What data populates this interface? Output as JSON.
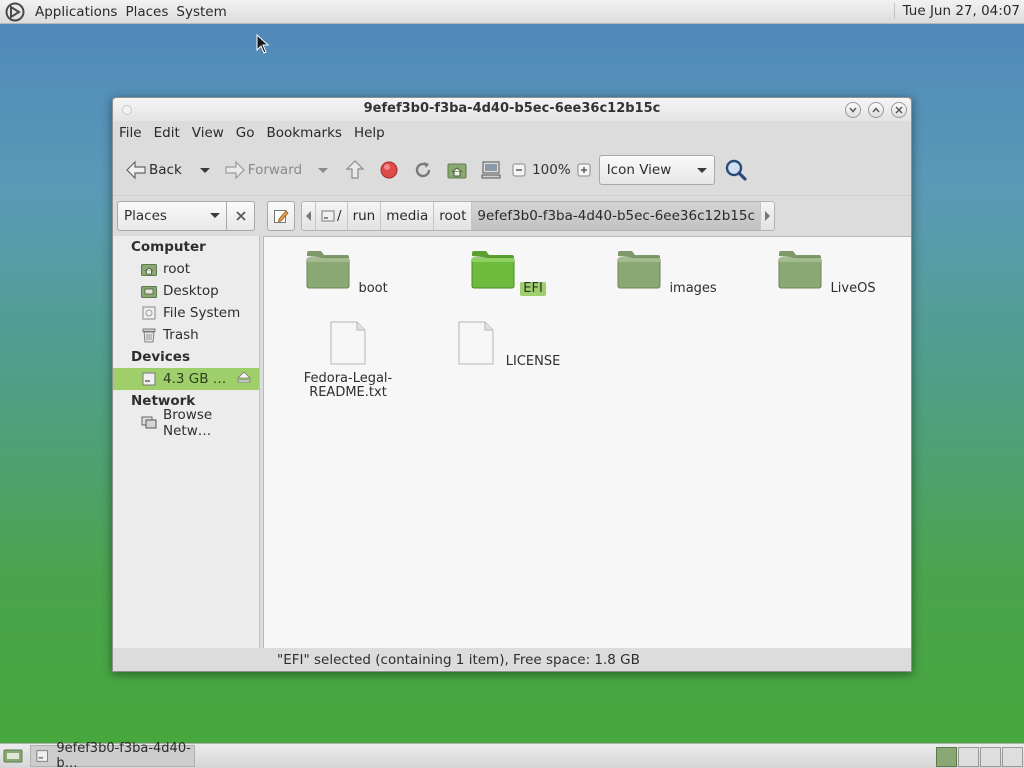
{
  "top_panel": {
    "menus": [
      "Applications",
      "Places",
      "System"
    ],
    "clock": "Tue Jun 27, 04:07"
  },
  "window": {
    "title": "9efef3b0-f3ba-4d40-b5ec-6ee36c12b15c",
    "menu": [
      "File",
      "Edit",
      "View",
      "Go",
      "Bookmarks",
      "Help"
    ],
    "toolbar": {
      "back_label": "Back",
      "forward_label": "Forward",
      "zoom": "100%",
      "view_mode": "Icon View"
    },
    "location": {
      "places_label": "Places",
      "crumbs": [
        "/",
        "run",
        "media",
        "root",
        "9efef3b0-f3ba-4d40-b5ec-6ee36c12b15c"
      ]
    },
    "sidebar": {
      "computer_heading": "Computer",
      "computer_items": [
        "root",
        "Desktop",
        "File System",
        "Trash"
      ],
      "devices_heading": "Devices",
      "device_item": "4.3 GB …",
      "network_heading": "Network",
      "network_item": "Browse Netw…"
    },
    "files": [
      {
        "name": "boot",
        "type": "folder"
      },
      {
        "name": "EFI",
        "type": "folder",
        "selected": true
      },
      {
        "name": "images",
        "type": "folder"
      },
      {
        "name": "LiveOS",
        "type": "folder"
      },
      {
        "name": "Fedora-Legal-README.txt",
        "line1": "Fedora-Legal-",
        "line2": "README.txt",
        "type": "file"
      },
      {
        "name": "LICENSE",
        "type": "file"
      }
    ],
    "status": "\"EFI\" selected (containing 1 item), Free space: 1.8 GB"
  },
  "taskbar": {
    "task_label": "9efef3b0-f3ba-4d40-b…"
  },
  "colors": {
    "selection": "#9fcf6a",
    "folder": "#8aa874"
  }
}
